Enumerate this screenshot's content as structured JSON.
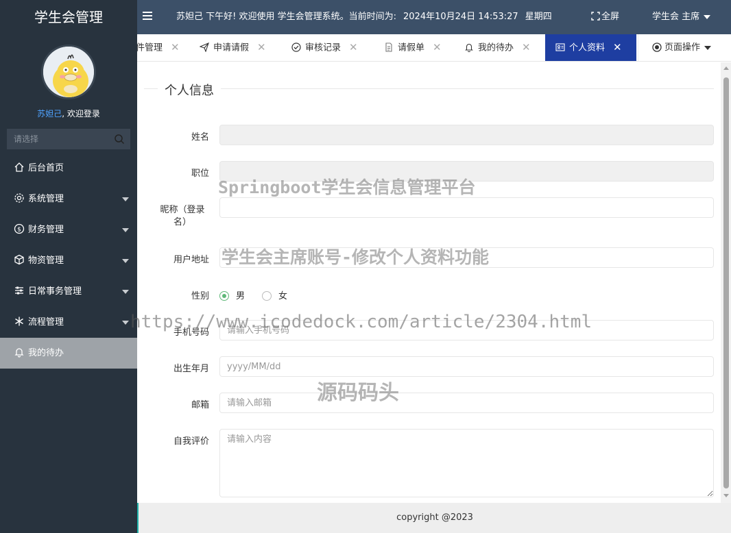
{
  "sidebar": {
    "brand": "学生会管理",
    "user_name": "苏妲己",
    "welcome_suffix": ", 欢迎登录",
    "search_placeholder": "请选择",
    "items": [
      {
        "label": "后台首页",
        "icon": "home-icon",
        "has_caret": false
      },
      {
        "label": "系统管理",
        "icon": "gear-icon",
        "has_caret": true
      },
      {
        "label": "财务管理",
        "icon": "dollar-icon",
        "has_caret": true
      },
      {
        "label": "物资管理",
        "icon": "cube-icon",
        "has_caret": true
      },
      {
        "label": "日常事务管理",
        "icon": "sliders-icon",
        "has_caret": true
      },
      {
        "label": "流程管理",
        "icon": "snowflake-icon",
        "has_caret": true
      },
      {
        "label": "我的待办",
        "icon": "bell-icon",
        "has_caret": false,
        "active": true
      }
    ]
  },
  "header": {
    "greeting": "苏妲己 下午好!  欢迎使用 学生会管理系统。当前时间为:",
    "datetime": "2024年10月24日 14:53:27",
    "weekday": "星期四",
    "fullscreen_label": "全屏",
    "role_label": "学生会 主席"
  },
  "tabs": {
    "items": [
      {
        "label": "件管理",
        "icon": ""
      },
      {
        "label": "申请请假",
        "icon": "paper-plane-icon"
      },
      {
        "label": "审核记录",
        "icon": "check-circle-icon"
      },
      {
        "label": "请假单",
        "icon": "file-icon"
      },
      {
        "label": "我的待办",
        "icon": "bell-icon"
      },
      {
        "label": "个人资料",
        "icon": "id-card-icon",
        "active": true
      }
    ],
    "close_glyph": "✕",
    "page_ops_label": "页面操作"
  },
  "form": {
    "section_title": "个人信息",
    "fields": {
      "name": {
        "label": "姓名",
        "value": "",
        "placeholder": ""
      },
      "position": {
        "label": "职位",
        "value": "",
        "placeholder": ""
      },
      "nickname": {
        "label": "昵称（登录名）",
        "value": "",
        "placeholder": ""
      },
      "address": {
        "label": "用户地址",
        "value": "",
        "placeholder": ""
      },
      "gender": {
        "label": "性别",
        "options": [
          "男",
          "女"
        ],
        "selected": "男"
      },
      "phone": {
        "label": "手机号码",
        "placeholder": "请输入手机号码"
      },
      "birthday": {
        "label": "出生年月",
        "placeholder": "yyyy/MM/dd"
      },
      "email": {
        "label": "邮箱",
        "placeholder": "请输入邮箱"
      },
      "bio": {
        "label": "自我评价",
        "placeholder": "请输入内容"
      }
    }
  },
  "footer": {
    "copyright": "copyright @2023"
  },
  "watermarks": {
    "line1": "Springboot学生会信息管理平台",
    "line2": "学生会主席账号-修改个人资料功能",
    "line3": "https://www.icodedock.com/article/2304.html",
    "line4": "源码码头"
  },
  "colors": {
    "sidebar_bg": "#28333e",
    "header_bg": "#3c5068",
    "active_tab": "#1e3ea1",
    "radio_checked": "#5fb878",
    "username": "#4fa3ff"
  }
}
